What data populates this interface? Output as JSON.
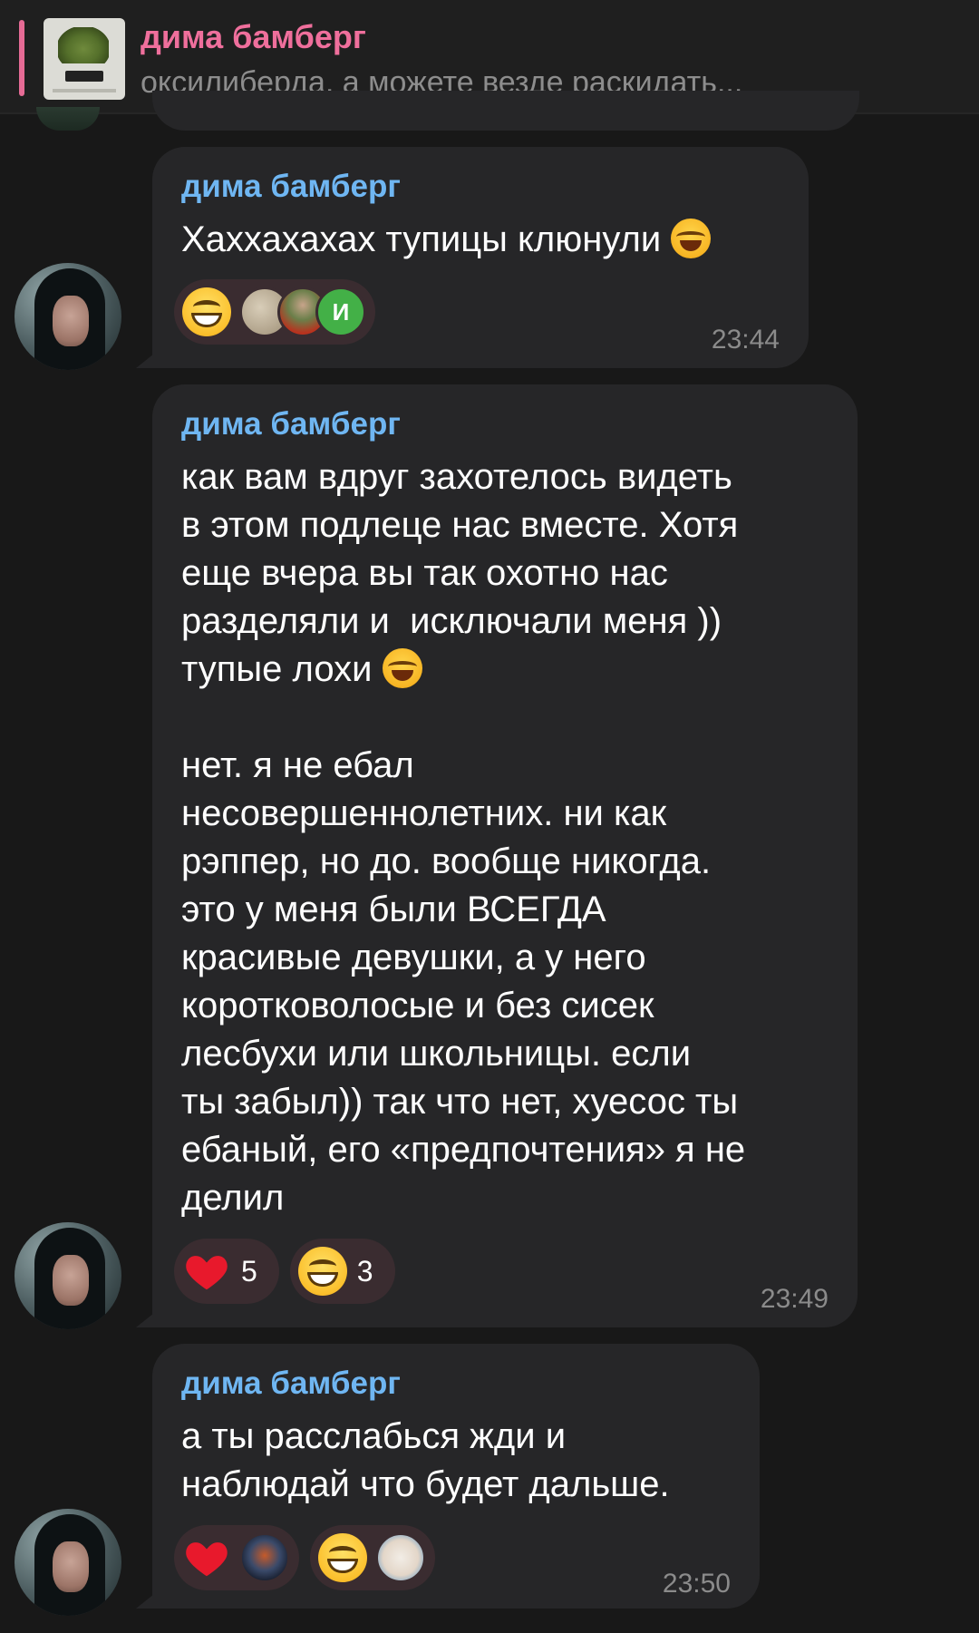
{
  "pinned": {
    "title": "дима бамберг",
    "text": "оксилиберда, а можете везде раскидать..."
  },
  "messages": [
    {
      "sender": "дима бамберг",
      "text": "Хаххахахах тупицы клюнули",
      "time": "23:44",
      "reactions": [
        {
          "emoji": "grinning-face",
          "avatars": [
            "beige-photo",
            "soldier-photo",
            "И"
          ]
        }
      ]
    },
    {
      "sender": "дима бамберг",
      "text_part1": "как вам вдруг захотелось видеть\nв этом подлеце нас вместе. Хотя\nеще вчера вы так охотно нас\nразделяли и  исключали меня ))\nтупые лохи",
      "text_part2": "нет. я не ебал\nнесовершеннолетних. ни как\nрэппер, но до. вообще никогда.\nэто у меня были ВСЕГДА\nкрасивые девушки, а у него\nкоротковолосые и без сисек\nлесбухи или школьницы. если\nты забыл)) так что нет, хуесос ты\nебаный, его «предпочтения» я не\nделил",
      "time": "23:49",
      "reactions": [
        {
          "emoji": "red-heart",
          "count": "5"
        },
        {
          "emoji": "grinning-face",
          "count": "3"
        }
      ]
    },
    {
      "sender": "дима бамберг",
      "text": "а ты расслабься жди и\nнаблюдай что будет дальше.",
      "time": "23:50",
      "reactions": [
        {
          "emoji": "red-heart",
          "avatars": [
            "dark-fantasy-photo"
          ]
        },
        {
          "emoji": "grinning-face",
          "avatars": [
            "cat-photo"
          ]
        }
      ]
    }
  ],
  "colors": {
    "background": "#181818",
    "bubble": "#262628",
    "sender_name": "#6fb6f2",
    "pinned_name": "#ef6f9c",
    "reaction_pill": "#3a2c30"
  }
}
